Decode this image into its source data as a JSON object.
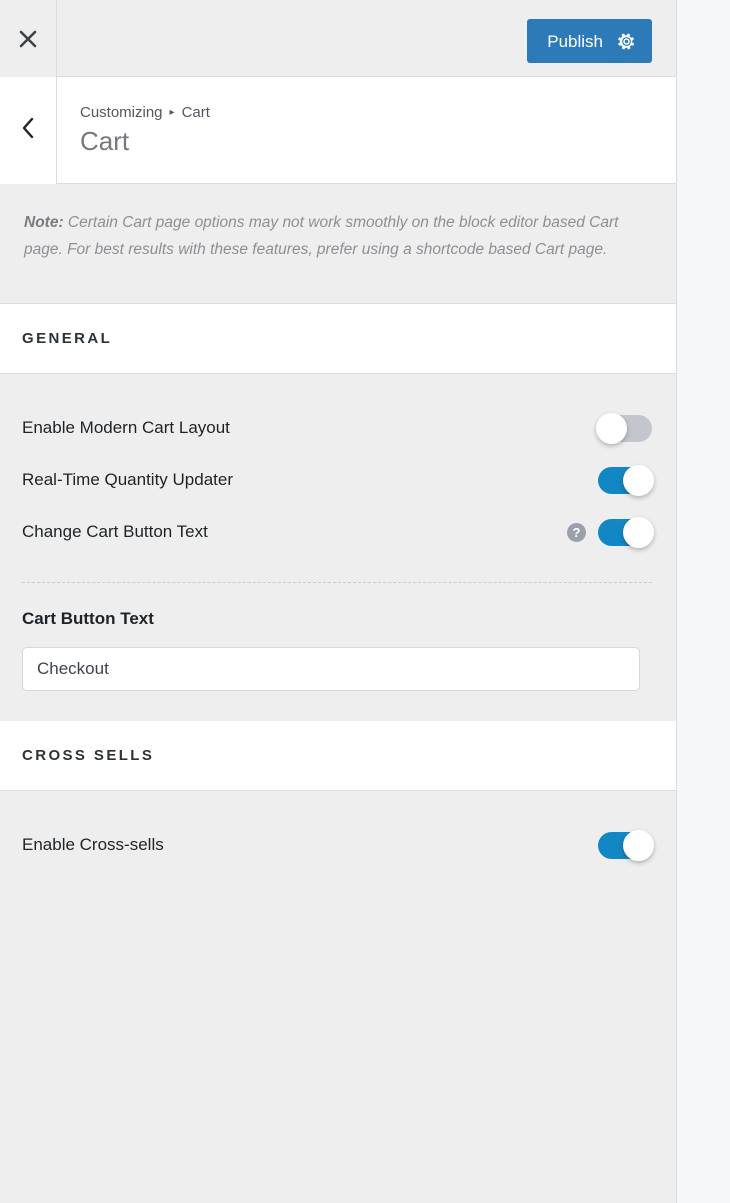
{
  "topbar": {
    "close_icon": "close-icon",
    "publish_label": "Publish",
    "gear_icon": "gear-icon",
    "publish_color": "#2d7ab8"
  },
  "panel_header": {
    "back_icon": "chevron-left-icon",
    "breadcrumb_root": "Customizing",
    "breadcrumb_separator": "▸",
    "breadcrumb_current": "Cart",
    "title": "Cart"
  },
  "note": {
    "label": "Note:",
    "text": " Certain Cart page options may not work smoothly on the block editor based Cart page. For best results with these features, prefer using a shortcode based Cart page."
  },
  "sections": [
    {
      "title": "GENERAL",
      "toggles": [
        {
          "label": "Enable Modern Cart Layout",
          "state": "off",
          "help": false
        },
        {
          "label": "Real-Time Quantity Updater",
          "state": "on",
          "help": false
        },
        {
          "label": "Change Cart Button Text",
          "state": "on",
          "help": true,
          "help_icon": "help-icon",
          "help_glyph": "?"
        }
      ],
      "field": {
        "label": "Cart Button Text",
        "value": "Checkout",
        "placeholder": ""
      }
    },
    {
      "title": "CROSS SELLS",
      "toggles": [
        {
          "label": "Enable Cross-sells",
          "state": "on",
          "help": false
        }
      ]
    }
  ],
  "colors": {
    "accent": "#1287c4",
    "publish": "#2d7ab8",
    "panel_bg": "#eeeeee",
    "card_bg": "#ffffff",
    "preview_bg": "#f6f7f9",
    "toggle_off": "#c3c7cd",
    "heading": "#2c3338",
    "muted": "#8c8f94"
  }
}
